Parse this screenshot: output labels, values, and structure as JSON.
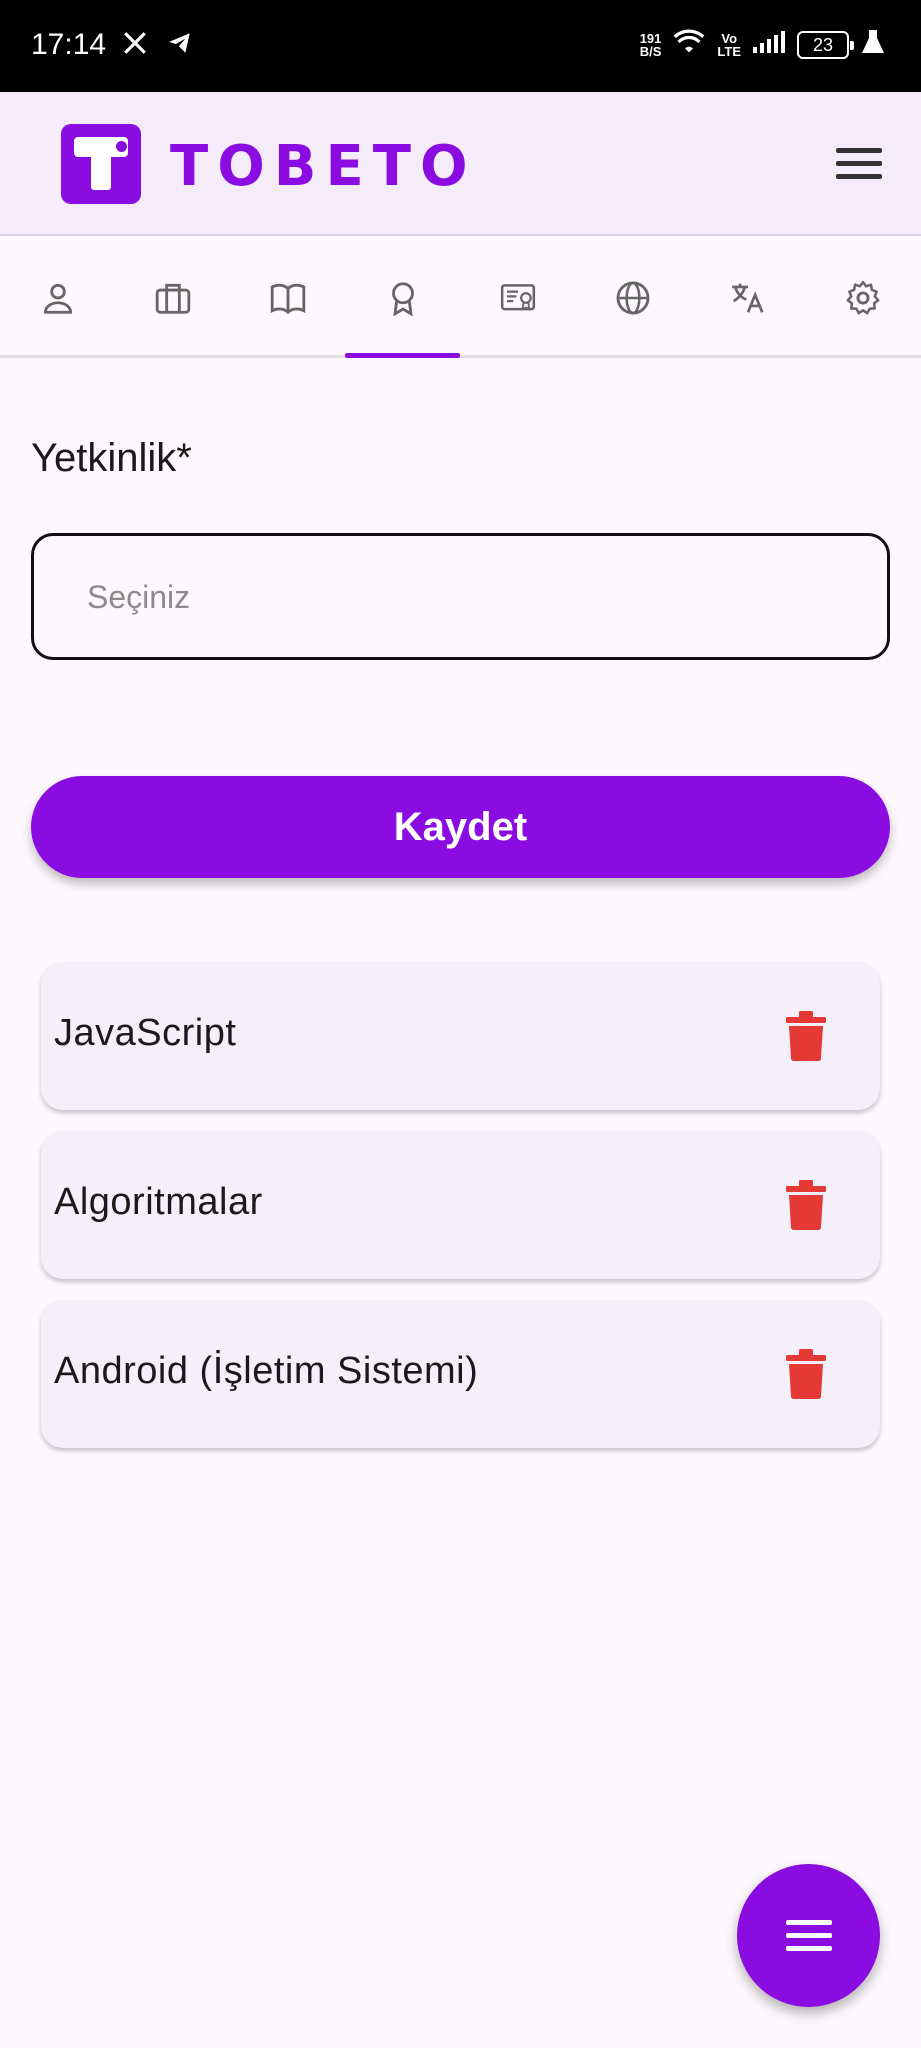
{
  "status_bar": {
    "time": "17:14",
    "net_speed_value": "191",
    "net_speed_unit": "B/S",
    "volte_top": "Vo",
    "volte_bottom": "LTE",
    "battery": "23"
  },
  "brand": {
    "name": "TOBETO",
    "accent": "#8a0ce0"
  },
  "tabs": [
    {
      "icon": "person-icon"
    },
    {
      "icon": "briefcase-icon"
    },
    {
      "icon": "book-icon"
    },
    {
      "icon": "award-icon",
      "selected": true
    },
    {
      "icon": "certificate-icon"
    },
    {
      "icon": "globe-icon"
    },
    {
      "icon": "translate-icon"
    },
    {
      "icon": "settings-icon"
    }
  ],
  "form": {
    "label": "Yetkinlik*",
    "placeholder": "Seçiniz",
    "save_label": "Kaydet"
  },
  "skills": [
    {
      "name": "JavaScript"
    },
    {
      "name": "Algoritmalar"
    },
    {
      "name": "Android (İşletim Sistemi)"
    }
  ],
  "colors": {
    "delete": "#e53935",
    "background": "#fdf8fd"
  }
}
